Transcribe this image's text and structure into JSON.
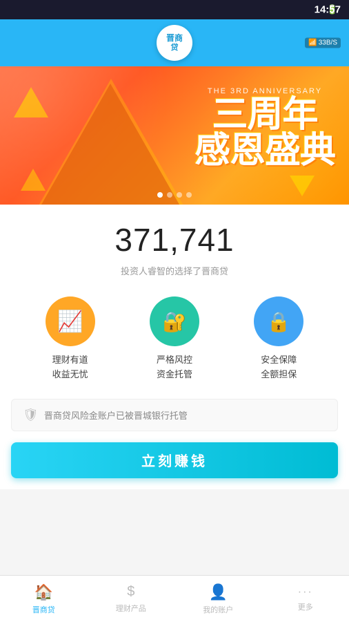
{
  "statusBar": {
    "time": "14:57",
    "battery": "🔋",
    "wifi": "33B/S"
  },
  "header": {
    "logoText": "晋\n商",
    "logoSubText": "贷"
  },
  "banner": {
    "subtitle": "THE 3RD ANNIVERSARY",
    "title": "三周年\n感恩盛典",
    "dots": [
      true,
      false,
      false,
      false
    ]
  },
  "stats": {
    "number": "371,741",
    "description": "投资人睿智的选择了晋商贷"
  },
  "features": [
    {
      "label": "理财有道\n收益无忧",
      "icon": "📈",
      "colorClass": "orange"
    },
    {
      "label": "严格风控\n资金托管",
      "icon": "🔐",
      "colorClass": "teal"
    },
    {
      "label": "安全保障\n全额担保",
      "icon": "🔒",
      "colorClass": "blue"
    }
  ],
  "trustBar": {
    "text": "晋商贷风险金账户已被晋城银行托管"
  },
  "cta": {
    "label": "立刻赚钱"
  },
  "bottomNav": [
    {
      "label": "晋商贷",
      "icon": "🏠",
      "active": true
    },
    {
      "label": "理财产品",
      "icon": "💲",
      "active": false
    },
    {
      "label": "我的账户",
      "icon": "👤",
      "active": false
    },
    {
      "label": "更多",
      "icon": "···",
      "active": false
    }
  ]
}
